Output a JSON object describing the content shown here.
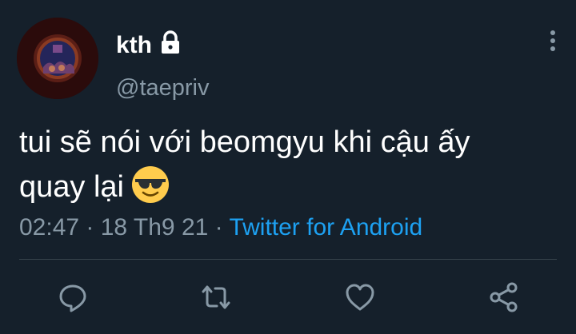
{
  "tweet": {
    "display_name": "kth",
    "handle": "@taepriv",
    "text_line1": "tui sẽ nói với beomgyu khi cậu ấy",
    "text_line2": "quay lại",
    "time": "02:47",
    "separator1": " · ",
    "date": "18 Th9 21",
    "separator2": " · ",
    "source": "Twitter for Android"
  },
  "icons": {
    "lock": "lock-icon",
    "more": "more-vertical-icon",
    "reply": "reply-icon",
    "retweet": "retweet-icon",
    "like": "heart-icon",
    "share": "share-icon",
    "emoji": "smiling-face-with-sunglasses"
  },
  "colors": {
    "background": "#15202b",
    "primary_text": "#ffffff",
    "secondary_text": "#8899a6",
    "link": "#1da1f2",
    "divider": "#38444d"
  }
}
